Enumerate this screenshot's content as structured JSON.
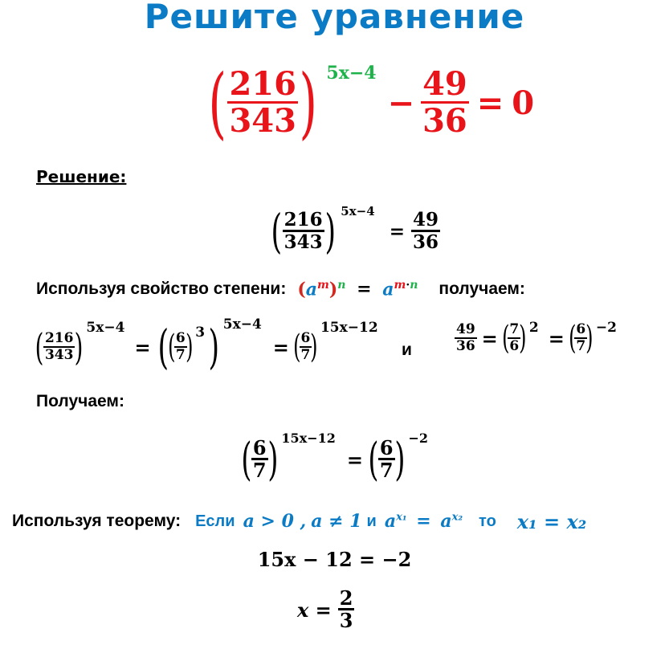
{
  "title": "Решите  уравнение",
  "problem": {
    "base_num": "216",
    "base_den": "343",
    "exponent": "5x−4",
    "minus": "−",
    "rhs_num": "49",
    "rhs_den": "36",
    "equals": "=",
    "zero": "0"
  },
  "solution_heading": "Решение:",
  "step1": {
    "base_num": "216",
    "base_den": "343",
    "exponent": "5x−4",
    "equals": "=",
    "rhs_num": "49",
    "rhs_den": "36"
  },
  "property_line": {
    "prefix": "Используя свойство степени:",
    "open_paren": "(",
    "a": "a",
    "m": "m",
    "close_paren": ")",
    "n": "n",
    "equals": "=",
    "a2": "a",
    "m2": "m",
    "dot": "·",
    "n2": "n",
    "suffix": "получаем:"
  },
  "step2": {
    "base_num": "216",
    "base_den": "343",
    "exp1": "5x−4",
    "eq1": "=",
    "inner_num": "6",
    "inner_den": "7",
    "inner_exp": "3",
    "outer_exp": "5x−4",
    "eq2": "=",
    "res_num": "6",
    "res_den": "7",
    "res_exp": "15x−12",
    "and": "и",
    "r_num": "49",
    "r_den": "36",
    "eq3": "=",
    "r2_num": "7",
    "r2_den": "6",
    "r2_exp": "2",
    "eq4": "=",
    "r3_num": "6",
    "r3_den": "7",
    "r3_exp": "−2"
  },
  "obtain_label": "Получаем:",
  "step3": {
    "l_num": "6",
    "l_den": "7",
    "l_exp": "15x−12",
    "equals": "=",
    "r_num": "6",
    "r_den": "7",
    "r_exp": "−2"
  },
  "theorem_line": {
    "prefix": "Используя теорему:",
    "if": "Если",
    "cond1": "a > 0 ,",
    "cond2": "a ≠ 1",
    "and": "и",
    "a1": "a",
    "x1_sup": "x₁",
    "eq": "=",
    "a2": "a",
    "x2_sup": "x₂",
    "then": "то",
    "concl": "x₁ = x₂"
  },
  "step4": "15x − 12 = −2",
  "answer": {
    "lhs": "x =",
    "num": "2",
    "den": "3"
  }
}
